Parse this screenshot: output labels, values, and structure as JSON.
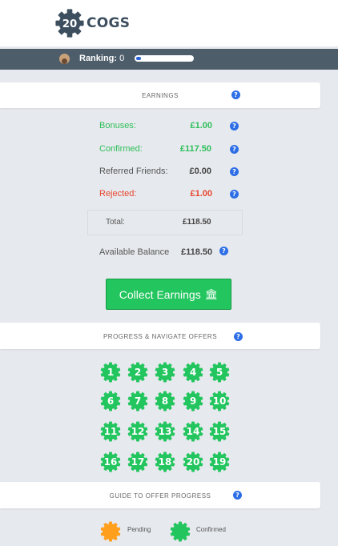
{
  "header": {
    "logo_number": "20",
    "logo_text": "COGS",
    "ranking_label": "Ranking:",
    "ranking_value": "0",
    "ranking_progress": 0.04
  },
  "earnings": {
    "title": "EARNINGS",
    "rows": [
      {
        "label": "Bonuses:",
        "value": "£1.00",
        "color": "#2ebf5a"
      },
      {
        "label": "Confirmed:",
        "value": "£117.50",
        "color": "#2ebf5a"
      },
      {
        "label": "Referred Friends:",
        "value": "£0.00",
        "color": "#555555"
      },
      {
        "label": "Rejected:",
        "value": "£1.00",
        "color": "#e8472f"
      }
    ],
    "total_label": "Total:",
    "total_value": "£118.50",
    "available_label": "Available Balance",
    "available_value": "£118.50",
    "collect_label": "Collect Earnings",
    "collect_icon": "bank-icon"
  },
  "progress": {
    "title": "PROGRESS & NAVIGATE OFFERS",
    "offers": [
      "1",
      "2",
      "3",
      "4",
      "5",
      "6",
      "7",
      "8",
      "9",
      "10",
      "11",
      "12",
      "13",
      "14",
      "15",
      "16",
      "17",
      "18",
      "20",
      "19"
    ],
    "offer_color": "#22c55e"
  },
  "guide": {
    "title": "GUIDE TO OFFER PROGRESS",
    "pending_label": "Pending",
    "pending_color": "#ff9f1c",
    "confirmed_label": "Confirmed",
    "confirmed_color": "#22c55e"
  },
  "colors": {
    "help_icon": "#2d6ee6",
    "rank_bar": "#4d5d6a",
    "brand_dark": "#3d4f5f"
  }
}
